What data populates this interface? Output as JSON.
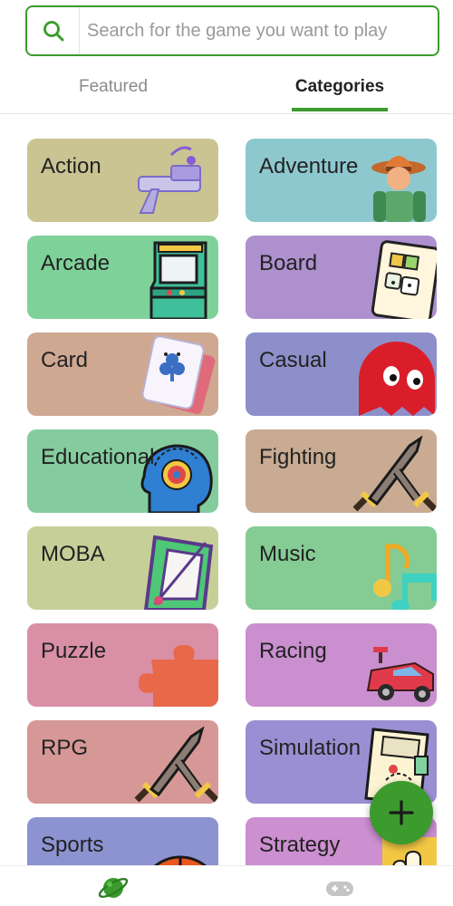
{
  "search": {
    "placeholder": "Search for the game you want to play",
    "value": ""
  },
  "tabs": [
    {
      "label": "Featured",
      "active": false
    },
    {
      "label": "Categories",
      "active": true
    }
  ],
  "categories": [
    {
      "label": "Action",
      "color": "#c9c492",
      "art": "pistol"
    },
    {
      "label": "Adventure",
      "color": "#8ec8cf",
      "art": "explorer"
    },
    {
      "label": "Arcade",
      "color": "#7fd19a",
      "art": "arcade-cabinet"
    },
    {
      "label": "Board",
      "color": "#ad90cd",
      "art": "board-game"
    },
    {
      "label": "Card",
      "color": "#cfa892",
      "art": "playing-card"
    },
    {
      "label": "Casual",
      "color": "#8d8fca",
      "art": "red-ghost"
    },
    {
      "label": "Educational",
      "color": "#84cc9e",
      "art": "head-gear"
    },
    {
      "label": "Fighting",
      "color": "#c8ab92",
      "art": "swords"
    },
    {
      "label": "MOBA",
      "color": "#c7cf98",
      "art": "moba-board"
    },
    {
      "label": "Music",
      "color": "#84cc94",
      "art": "music-notes"
    },
    {
      "label": "Puzzle",
      "color": "#d98fa6",
      "art": "puzzle-piece"
    },
    {
      "label": "Racing",
      "color": "#c98fce",
      "art": "race-car"
    },
    {
      "label": "RPG",
      "color": "#d69896",
      "art": "swords"
    },
    {
      "label": "Simulation",
      "color": "#9a8fd3",
      "art": "map-scroll"
    },
    {
      "label": "Sports",
      "color": "#8c93d0",
      "art": "basketball"
    },
    {
      "label": "Strategy",
      "color": "#cc8fd0",
      "art": "strategy-hand"
    }
  ],
  "fab": {
    "icon": "plus-icon",
    "color": "#3b9b2d"
  },
  "bottom_nav": [
    {
      "icon": "planet-icon",
      "active": true,
      "color": "#3b9b2d"
    },
    {
      "icon": "gamepad-icon",
      "active": false,
      "color": "#c4c4c4"
    }
  ]
}
